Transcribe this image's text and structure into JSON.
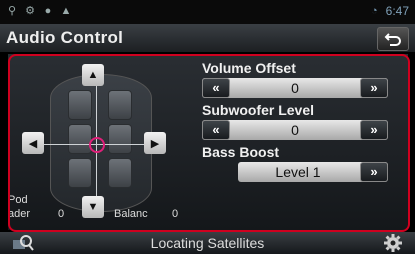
{
  "status": {
    "time": "6:47"
  },
  "header": {
    "title": "Audio Control"
  },
  "fader": {
    "pod_label": "Pod",
    "fader_label": "ader",
    "fader_value": "0",
    "balance_label": "Balanc",
    "balance_value": "0"
  },
  "settings": {
    "volume_offset": {
      "label": "Volume Offset",
      "value": "0",
      "dec": "«",
      "inc": "»"
    },
    "subwoofer_level": {
      "label": "Subwoofer Level",
      "value": "0",
      "dec": "«",
      "inc": "»"
    },
    "bass_boost": {
      "label": "Bass Boost",
      "value": "Level 1",
      "inc": "»"
    }
  },
  "footer": {
    "status": "Locating Satellites"
  }
}
